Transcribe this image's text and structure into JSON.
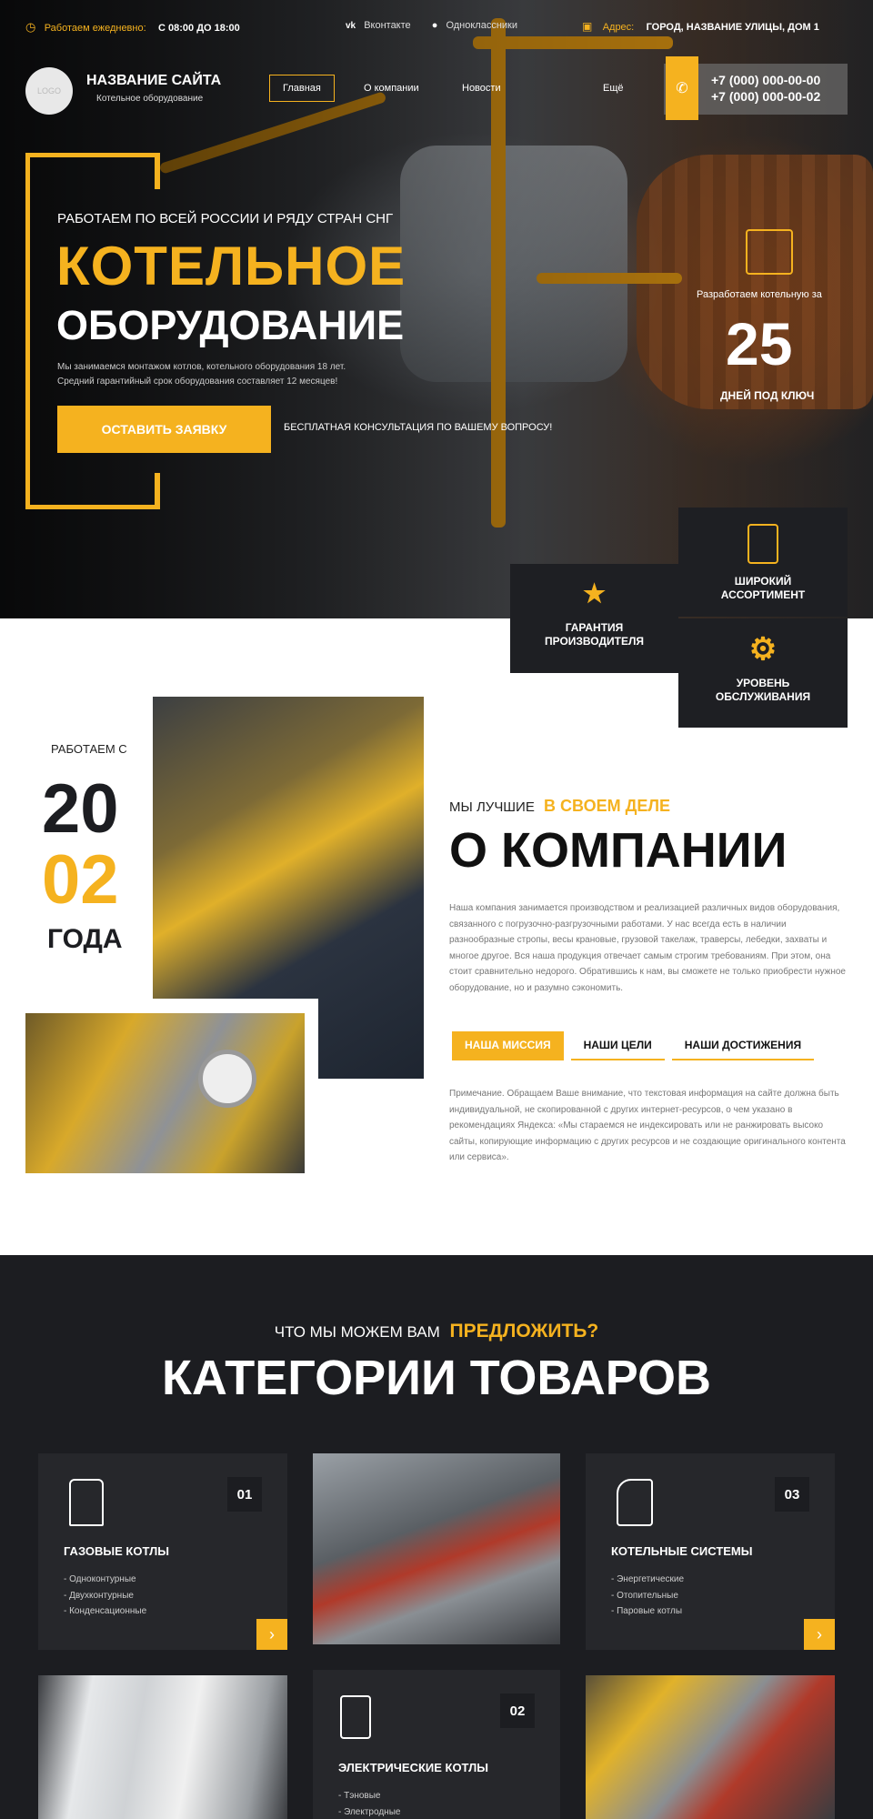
{
  "topbar": {
    "hours_label": "Работаем ежедневно:",
    "hours_value": "С 08:00 ДО 18:00",
    "social_vk": "Вконтакте",
    "social_ok": "Одноклассники",
    "address_label": "Адрес:",
    "address_value": "ГОРОД, НАЗВАНИЕ УЛИЦЫ, ДОМ 1"
  },
  "header": {
    "logo_text": "LOGO",
    "site_name": "НАЗВАНИЕ САЙТА",
    "site_subtitle": "Котельное оборудование",
    "nav": [
      "Главная",
      "О компании",
      "Новости",
      "Ещё"
    ],
    "phone1": "+7 (000) 000-00-00",
    "phone2": "+7 (000) 000-00-02"
  },
  "hero": {
    "tagline": "РАБОТАЕМ ПО ВСЕЙ РОССИИ И РЯДУ СТРАН СНГ",
    "title_line1": "КОТЕЛЬНОЕ",
    "title_line2": "ОБОРУДОВАНИЕ",
    "desc_line1": "Мы занимаемся монтажом котлов, котельного оборудования 18 лет.",
    "desc_line2": "Средний гарантийный срок оборудования составляет 12 месяцев!",
    "cta_label": "ОСТАВИТЬ ЗАЯВКУ",
    "cta_note": "БЕСПЛАТНАЯ КОНСУЛЬТАЦИЯ ПО ВАШЕМУ ВОПРОСУ!",
    "stat_label": "Разработаем котельную за",
    "stat_value": "25",
    "stat_unit": "ДНЕЙ ПОД КЛЮЧ"
  },
  "features": [
    {
      "label": "ШИРОКИЙ АССОРТИМЕНТ",
      "icon": "boiler-panel-icon"
    },
    {
      "label": "ГАРАНТИЯ ПРОИЗВОДИТЕЛЯ",
      "icon": "stars-hand-icon"
    },
    {
      "label": "УРОВЕНЬ ОБСЛУЖИВАНИЯ",
      "icon": "gear-service-icon"
    }
  ],
  "about": {
    "since_label": "РАБОТАЕМ С",
    "year_top": "20",
    "year_bottom": "02",
    "years_word": "ГОДА",
    "pre_title": "МЫ ЛУЧШИЕ",
    "pre_title_accent": "В СВОЕМ ДЕЛЕ",
    "title": "О КОМПАНИИ",
    "text": "Наша компания занимается производством и реализацией различных видов оборудования, связанного с погрузочно-разгрузочными работами. У нас всегда есть в наличии разнообразные стропы, весы крановые, грузовой такелаж, траверсы, лебедки, захваты и многое другое. Вся наша продукция отвечает самым строгим требованиям. При этом, она стоит сравнительно недорого. Обратившись к нам, вы сможете не только приобрести нужное оборудование, но и разумно сэкономить.",
    "tabs": [
      "НАША МИССИЯ",
      "НАШИ ЦЕЛИ",
      "НАШИ ДОСТИЖЕНИЯ"
    ],
    "note": "Примечание. Обращаем Ваше внимание, что текстовая информация на сайте должна быть индивидуальной, не скопированной с других интернет-ресурсов, о чем указано в рекомендациях Яндекса: «Мы стараемся не индексировать или не ранжировать высоко сайты, копирующие информацию с других ресурсов и не создающие оригинального контента или сервиса»."
  },
  "categories": {
    "pre_title": "ЧТО МЫ МОЖЕМ ВАМ",
    "pre_title_accent": "ПРЕДЛОЖИТЬ?",
    "title": "КАТЕГОРИИ ТОВАРОВ",
    "items": [
      {
        "num": "01",
        "title": "ГАЗОВЫЕ КОТЛЫ",
        "lines": [
          "- Одноконтурные",
          "- Двухконтурные",
          "- Конденсационные"
        ]
      },
      {
        "num": "03",
        "title": "КОТЕЛЬНЫЕ СИСТЕМЫ",
        "lines": [
          "- Энергетические",
          "- Отопительные",
          "- Паровые котлы"
        ]
      },
      {
        "num": "02",
        "title": "ЭЛЕКТРИЧЕСКИЕ КОТЛЫ",
        "lines": [
          "- Тэновые",
          "- Электродные"
        ]
      }
    ]
  },
  "colors": {
    "accent": "#f5b21f",
    "dark": "#1c1d21"
  }
}
